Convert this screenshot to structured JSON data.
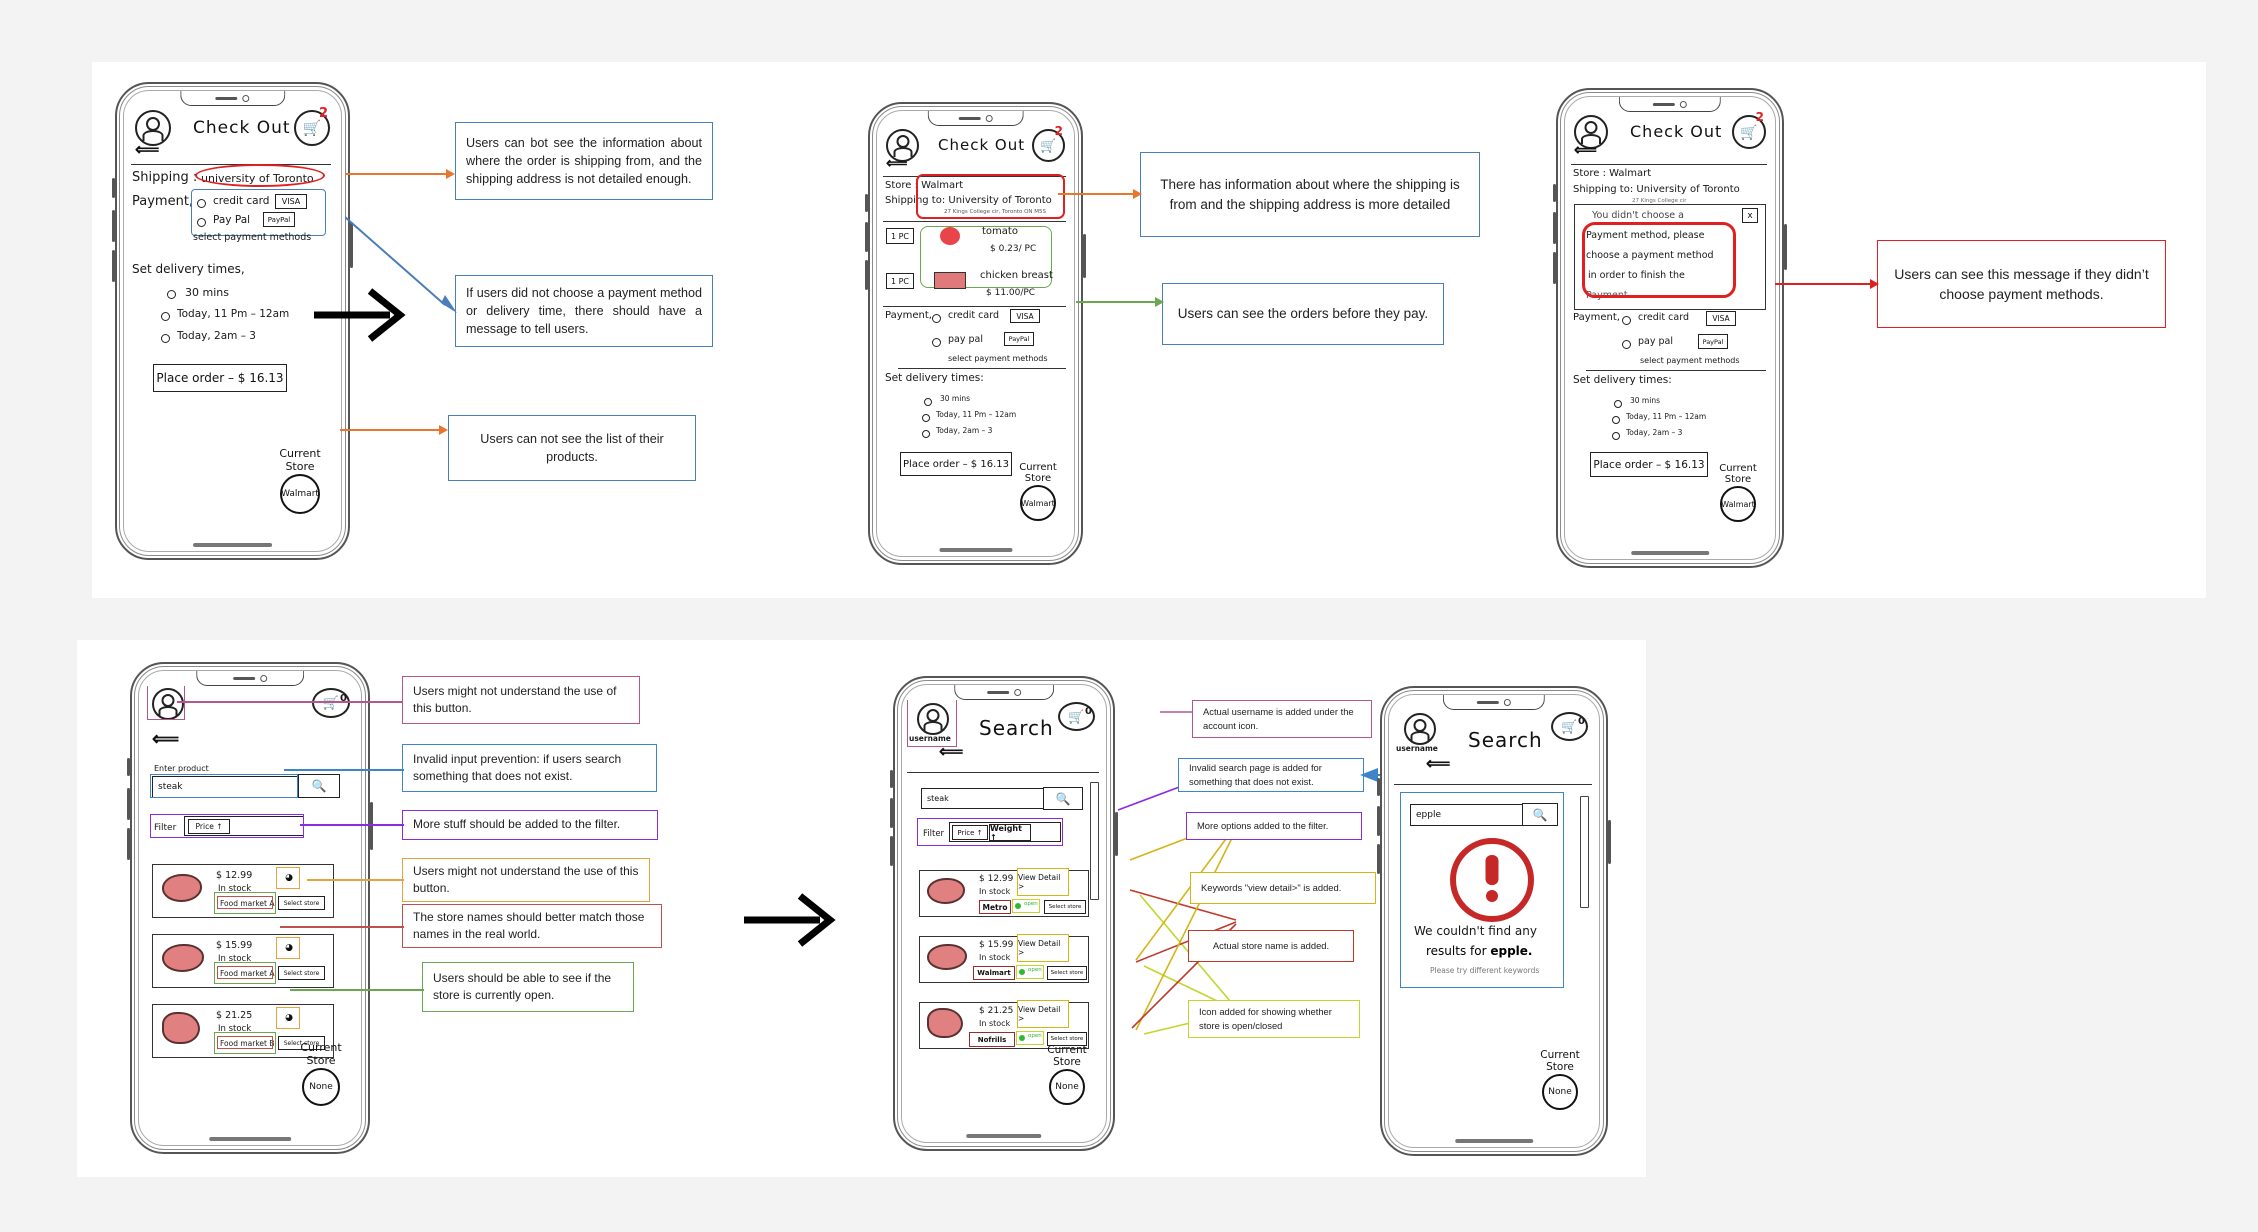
{
  "page": {
    "background": "#f3f3f3",
    "panel_background": "#ffffff",
    "flow_arrow": "⟶"
  },
  "colors": {
    "blue": "#4a7ebb",
    "orange": "#e8762c",
    "green": "#6aa84f",
    "red": "#e02020",
    "dark_red": "#c0392b",
    "pink": "#b5578a",
    "purple": "#8a2be2",
    "violet": "#7030a0",
    "yellow": "#d4b516",
    "gold": "#e8a33d",
    "yellow_green": "#c3d62b",
    "brown_red": "#c0504d"
  },
  "row1": {
    "phone_a": {
      "title": "Check Out",
      "cart_badge": "2",
      "shipping_label": "Shipping :",
      "shipping_value": "university of Toronto",
      "payment_label": "Payment,",
      "payment_options": [
        {
          "label": "credit card",
          "badge": "VISA"
        },
        {
          "label": "Pay Pal",
          "badge": "PayPal"
        }
      ],
      "payment_hint": "select payment methods",
      "delivery_label": "Set delivery times,",
      "delivery_options": [
        "30 mins",
        "Today, 11 Pm – 12am",
        "Today,  2am – 3"
      ],
      "place_order": "Place order – $ 16.13",
      "current_store_label_1": "Current",
      "current_store_label_2": "Store",
      "current_store_value": "Walmart"
    },
    "phone_b": {
      "title": "Check Out",
      "cart_badge": "2",
      "store_line": "Store : Walmart",
      "shipping_line": "Shipping to: University of Toronto",
      "shipping_sub": "27 Kings College cir, Toronto ON M5S",
      "items": [
        {
          "qty": "1 PC",
          "name": "tomato",
          "price": "$ 0.23/ PC",
          "icon": "tomato-icon"
        },
        {
          "qty": "1 PC",
          "name": "chicken breast",
          "price": "$ 11.00/PC",
          "icon": "chicken-icon"
        }
      ],
      "payment_label": "Payment,",
      "payment_options": [
        {
          "label": "credit card",
          "badge": "VISA"
        },
        {
          "label": "pay pal",
          "badge": "PayPal"
        }
      ],
      "payment_hint": "select payment methods",
      "delivery_label": "Set delivery times:",
      "delivery_options": [
        "30 mins",
        "Today, 11 Pm – 12am",
        "Today,  2am – 3"
      ],
      "place_order": "Place order – $ 16.13",
      "current_store_label_1": "Current",
      "current_store_label_2": "Store",
      "current_store_value": "Walmart"
    },
    "phone_c": {
      "title": "Check Out",
      "cart_badge": "2",
      "store_line": "Store : Walmart",
      "shipping_line": "Shipping to: University of Toronto",
      "shipping_sub": "27 Kings College cir",
      "alert_close": "x",
      "alert_lines": [
        "You didn't choose a",
        "Payment method, please",
        "choose a payment method",
        "in order to finish the",
        "Payment."
      ],
      "payment_label": "Payment,",
      "payment_options": [
        {
          "label": "credit card",
          "badge": "VISA"
        },
        {
          "label": "pay pal",
          "badge": "PayPal"
        }
      ],
      "payment_hint": "select payment methods",
      "delivery_label": "Set delivery times:",
      "delivery_options": [
        "30 mins",
        "Today, 11 Pm – 12am",
        "Today,  2am – 3"
      ],
      "place_order": "Place order – $ 16.13",
      "current_store_label_1": "Current",
      "current_store_label_2": "Store",
      "current_store_value": "Walmart"
    },
    "callouts": [
      {
        "id": "c1",
        "text": "Users can bot see the information about where the order is shipping from, and the shipping address is not detailed enough.",
        "border": "#4a7ebb",
        "arrow": "#e8762c"
      },
      {
        "id": "c2",
        "text": "If users did not choose a payment method or delivery time, there should have a message to tell users.",
        "border": "#4a7ebb",
        "arrow": "#4a7ebb"
      },
      {
        "id": "c3",
        "text": "Users can not see the list of their products.",
        "border": "#4a7ebb",
        "arrow": "#e8762c"
      },
      {
        "id": "c4",
        "text": "There has information about where the shipping is from and the shipping address is more detailed",
        "border": "#4a7ebb",
        "arrow": "#e8762c"
      },
      {
        "id": "c5",
        "text": "Users can see the orders before they pay.",
        "border": "#4a7ebb",
        "arrow": "#6aa84f"
      },
      {
        "id": "c6",
        "text": "Users can see this message if they didn’t choose payment methods.",
        "border": "#e02020",
        "arrow": "#e02020"
      }
    ]
  },
  "row2": {
    "phone_a": {
      "cart_badge": "0",
      "back": "⟵",
      "search_label": "Enter product",
      "search_value": "steak",
      "search_icon": "magnifier-icon",
      "filter_label": "Filter",
      "filter_chips": [
        "Price ↑"
      ],
      "products": [
        {
          "price": "$ 12.99",
          "stock": "In stock",
          "store": "Food market A",
          "select": "Select store",
          "icon": "steak-icon"
        },
        {
          "price": "$ 15.99",
          "stock": "In stock",
          "store": "Food market A",
          "select": "Select store",
          "icon": "steak-icon"
        },
        {
          "price": "$ 21.25",
          "stock": "In stock",
          "store": "Food market B",
          "select": "Select store",
          "icon": "chicken-leg-icon"
        }
      ],
      "current_store_label_1": "Current",
      "current_store_label_2": "Store",
      "current_store_value": "None"
    },
    "phone_b": {
      "title": "Search",
      "cart_badge": "0",
      "username": "username",
      "back": "⟵",
      "search_value": "steak",
      "search_icon": "magnifier-icon",
      "filter_label": "Filter",
      "filter_chips": [
        "Price ↑",
        "Weight ↑"
      ],
      "products": [
        {
          "price": "$ 12.99",
          "stock": "In stock",
          "store": "Metro",
          "open": "open",
          "select": "Select store",
          "detail": "View Detail >",
          "icon": "steak-icon"
        },
        {
          "price": "$ 15.99",
          "stock": "In stock",
          "store": "Walmart",
          "open": "open",
          "select": "Select store",
          "detail": "View Detail >",
          "icon": "steak-icon"
        },
        {
          "price": "$ 21.25",
          "stock": "In stock",
          "store": "Nofrills",
          "open": "open",
          "select": "Select store",
          "detail": "View Detail >",
          "icon": "chicken-leg-icon"
        }
      ],
      "current_store_label_1": "Current",
      "current_store_label_2": "Store",
      "current_store_value": "None"
    },
    "phone_c": {
      "title": "Search",
      "cart_badge": "0",
      "username": "username",
      "back": "⟵",
      "search_value": "epple",
      "search_icon": "magnifier-icon",
      "error_icon": "exclamation-circle-icon",
      "error_line1": "We couldn't find any",
      "error_line2_pre": "results for ",
      "error_line2_bold": "epple.",
      "error_hint": "Please try different keywords",
      "current_store_label_1": "Current",
      "current_store_label_2": "Store",
      "current_store_value": "None"
    },
    "callouts": [
      {
        "id": "d1",
        "text": "Users might not understand the use of this button.",
        "border": "#b5578a"
      },
      {
        "id": "d2",
        "text": "Invalid input prevention: if users search something that does not exist.",
        "border": "#3d85c8"
      },
      {
        "id": "d3",
        "text": "More stuff should be added to the filter.",
        "border": "#8a2be2"
      },
      {
        "id": "d4",
        "text": "Users might not understand the use of this button.",
        "border": "#e8a33d"
      },
      {
        "id": "d5",
        "text": "The store names should better match those names in the real world.",
        "border": "#c0504d"
      },
      {
        "id": "d6",
        "text": "Users should be able to see if the store is currently open.",
        "border": "#6aa84f"
      },
      {
        "id": "d7",
        "text": "Actual username is added under the account icon.",
        "border": "#b5578a"
      },
      {
        "id": "d8",
        "text": "Invalid search page is added for something that does not exist.",
        "border": "#3d85c8"
      },
      {
        "id": "d9",
        "text": "More options added to the filter.",
        "border": "#8a2be2"
      },
      {
        "id": "d10",
        "text": "Keywords \"view detail>\" is added.",
        "border": "#d4b516"
      },
      {
        "id": "d11",
        "text": "Actual store name is added.",
        "border": "#c0392b"
      },
      {
        "id": "d12",
        "text": "Icon added for showing whether store is open/closed",
        "border": "#c3d62b"
      }
    ]
  }
}
